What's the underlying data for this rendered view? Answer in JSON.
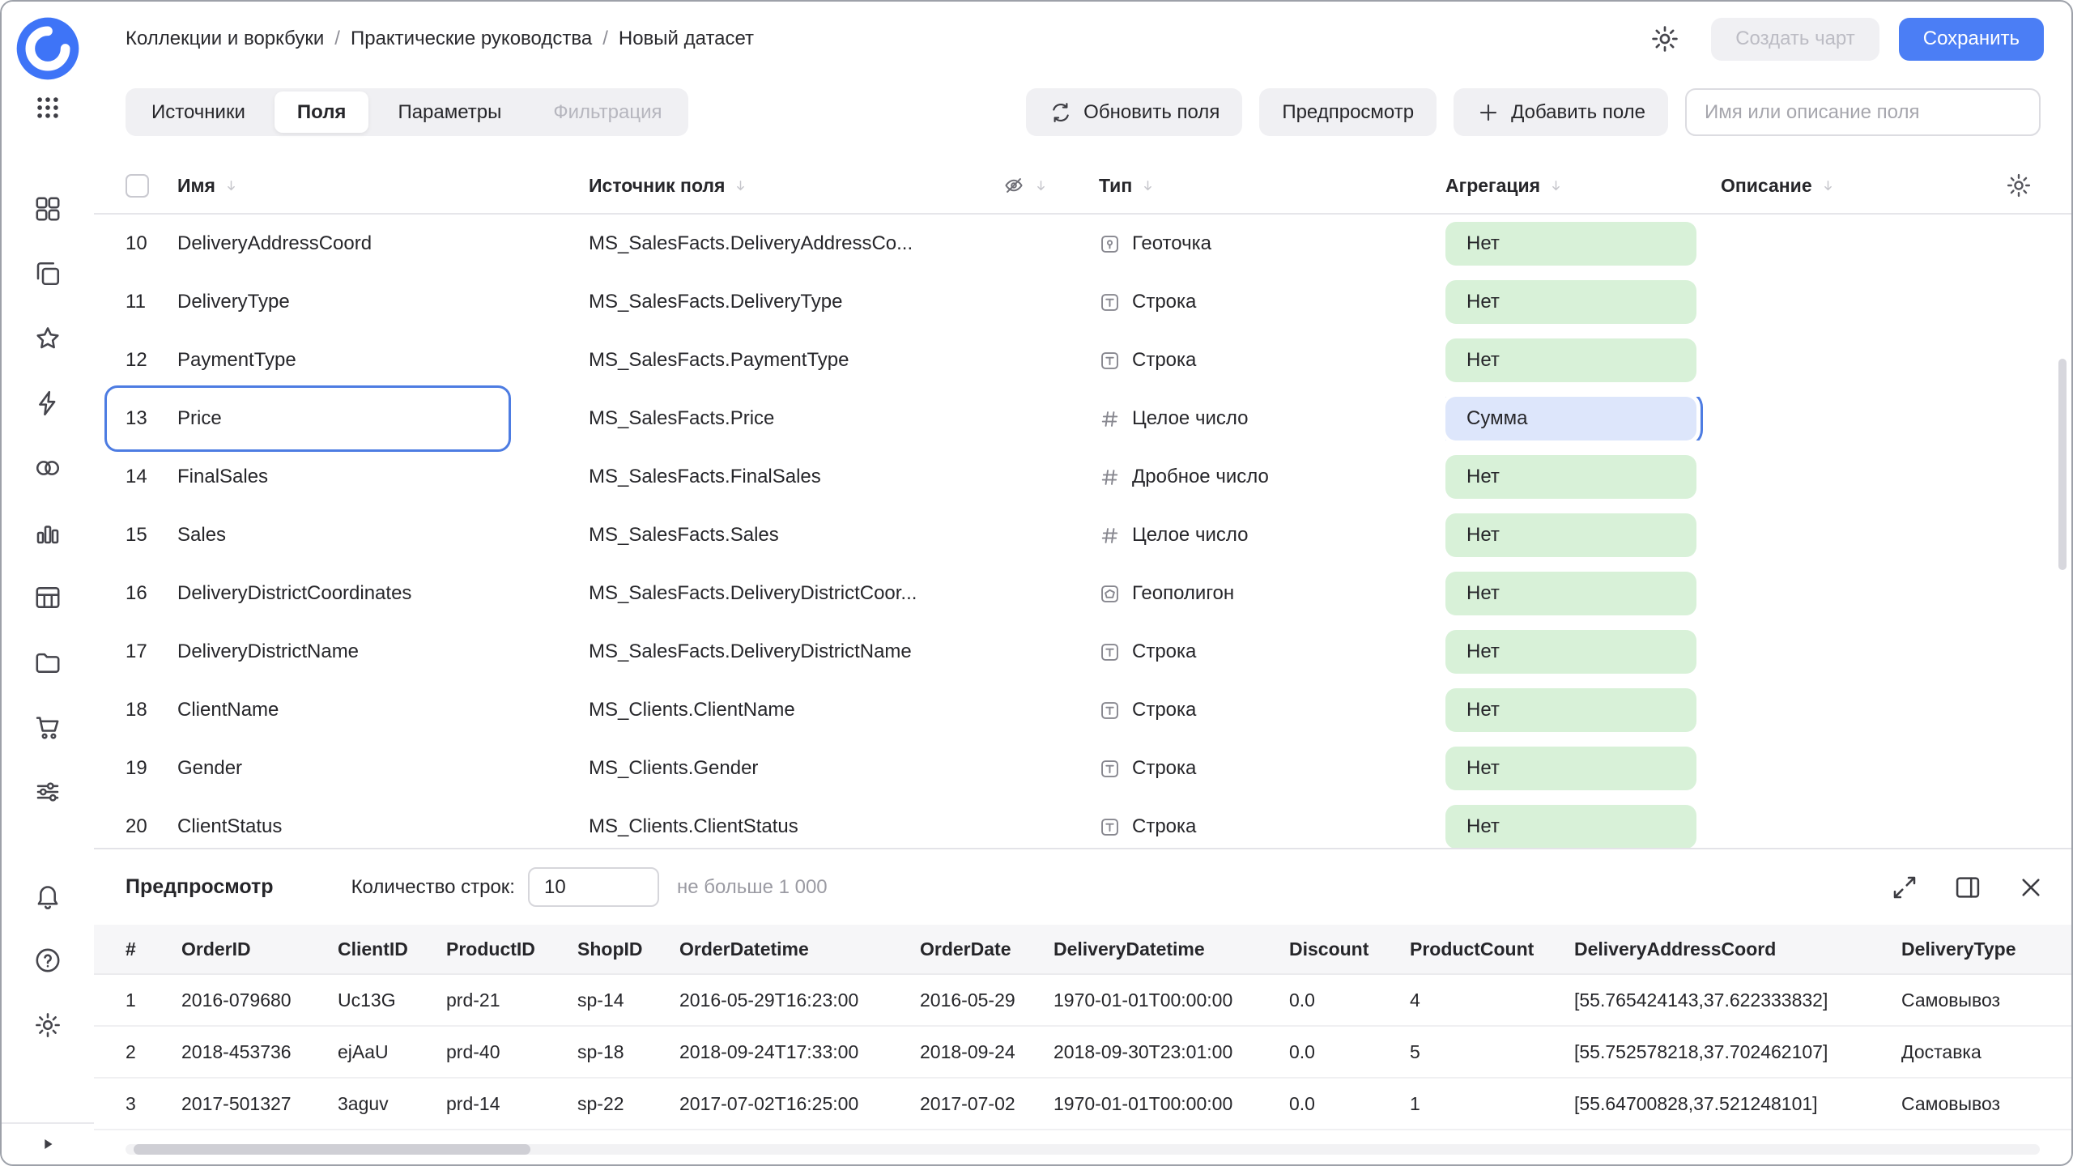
{
  "colors": {
    "accent-blue": "#4b7ef5",
    "select-blue": "#4d7ce2",
    "pill-green-bg": "#d8f1d8",
    "pill-blue-bg": "#dde6fb",
    "btn-gray-bg": "#f0f0f3"
  },
  "header": {
    "breadcrumb": [
      "Коллекции и воркбуки",
      "Практические руководства",
      "Новый датасет"
    ],
    "breadcrumb_separator": "/",
    "create_chart_label": "Создать чарт",
    "save_label": "Сохранить"
  },
  "toolbar": {
    "tabs": [
      {
        "label": "Источники",
        "state": "normal"
      },
      {
        "label": "Поля",
        "state": "active"
      },
      {
        "label": "Параметры",
        "state": "normal"
      },
      {
        "label": "Фильтрация",
        "state": "disabled"
      }
    ],
    "refresh_label": "Обновить поля",
    "preview_label": "Предпросмотр",
    "add_field_label": "Добавить поле",
    "search_placeholder": "Имя или описание поля"
  },
  "icons": {
    "sidebar_logo": "datalens-logo",
    "sidebar_apps": "apps-grid-icon",
    "header_settings": "gear-icon",
    "refresh_button": "refresh-icon",
    "add_field_button": "plus-icon",
    "column_sort": "sort-down-icon",
    "hidden_column": "eye-off-icon",
    "table_settings": "gear-icon",
    "preview_expand": "expand-icon",
    "preview_dock": "panel-right-icon",
    "preview_close": "close-icon",
    "sidebar_footer": "play-icon"
  },
  "sidebar": {
    "icons": [
      "dashboards",
      "copy",
      "star",
      "lightning",
      "circles",
      "bar-chart",
      "table",
      "folder",
      "cart",
      "sliders"
    ],
    "bottom_icons": [
      "bell",
      "question",
      "gear"
    ]
  },
  "fields_table": {
    "columns": {
      "name": "Имя",
      "source": "Источник поля",
      "type": "Тип",
      "aggregation": "Агрегация",
      "description": "Описание"
    },
    "rows": [
      {
        "num": 10,
        "name": "DeliveryAddressCoord",
        "source": "MS_SalesFacts.DeliveryAddressCo...",
        "type": "Геоточка",
        "type_icon": "geopoint",
        "aggregation": "Нет"
      },
      {
        "num": 11,
        "name": "DeliveryType",
        "source": "MS_SalesFacts.DeliveryType",
        "type": "Строка",
        "type_icon": "string",
        "aggregation": "Нет"
      },
      {
        "num": 12,
        "name": "PaymentType",
        "source": "MS_SalesFacts.PaymentType",
        "type": "Строка",
        "type_icon": "string",
        "aggregation": "Нет"
      },
      {
        "num": 13,
        "name": "Price",
        "source": "MS_SalesFacts.Price",
        "type": "Целое число",
        "type_icon": "integer",
        "aggregation": "Сумма",
        "selected": true
      },
      {
        "num": 14,
        "name": "FinalSales",
        "source": "MS_SalesFacts.FinalSales",
        "type": "Дробное число",
        "type_icon": "float",
        "aggregation": "Нет"
      },
      {
        "num": 15,
        "name": "Sales",
        "source": "MS_SalesFacts.Sales",
        "type": "Целое число",
        "type_icon": "integer",
        "aggregation": "Нет"
      },
      {
        "num": 16,
        "name": "DeliveryDistrictCoordinates",
        "source": "MS_SalesFacts.DeliveryDistrictCoor...",
        "type": "Геополигон",
        "type_icon": "geopolygon",
        "aggregation": "Нет"
      },
      {
        "num": 17,
        "name": "DeliveryDistrictName",
        "source": "MS_SalesFacts.DeliveryDistrictName",
        "type": "Строка",
        "type_icon": "string",
        "aggregation": "Нет"
      },
      {
        "num": 18,
        "name": "ClientName",
        "source": "MS_Clients.ClientName",
        "type": "Строка",
        "type_icon": "string",
        "aggregation": "Нет"
      },
      {
        "num": 19,
        "name": "Gender",
        "source": "MS_Clients.Gender",
        "type": "Строка",
        "type_icon": "string",
        "aggregation": "Нет"
      },
      {
        "num": 20,
        "name": "ClientStatus",
        "source": "MS_Clients.ClientStatus",
        "type": "Строка",
        "type_icon": "string",
        "aggregation": "Нет"
      }
    ]
  },
  "preview": {
    "title": "Предпросмотр",
    "row_count_label": "Количество строк:",
    "row_count_value": "10",
    "row_count_hint": "не больше 1 000",
    "columns": [
      "#",
      "OrderID",
      "ClientID",
      "ProductID",
      "ShopID",
      "OrderDatetime",
      "OrderDate",
      "DeliveryDatetime",
      "Discount",
      "ProductCount",
      "DeliveryAddressCoord",
      "DeliveryType"
    ],
    "rows": [
      [
        "1",
        "2016-079680",
        "Uc13G",
        "prd-21",
        "sp-14",
        "2016-05-29T16:23:00",
        "2016-05-29",
        "1970-01-01T00:00:00",
        "0.0",
        "4",
        "[55.765424143,37.622333832]",
        "Самовывоз"
      ],
      [
        "2",
        "2018-453736",
        "ejAaU",
        "prd-40",
        "sp-18",
        "2018-09-24T17:33:00",
        "2018-09-24",
        "2018-09-30T23:01:00",
        "0.0",
        "5",
        "[55.752578218,37.702462107]",
        "Доставка"
      ],
      [
        "3",
        "2017-501327",
        "3aguv",
        "prd-14",
        "sp-22",
        "2017-07-02T16:25:00",
        "2017-07-02",
        "1970-01-01T00:00:00",
        "0.0",
        "1",
        "[55.64700828,37.521248101]",
        "Самовывоз"
      ]
    ]
  }
}
